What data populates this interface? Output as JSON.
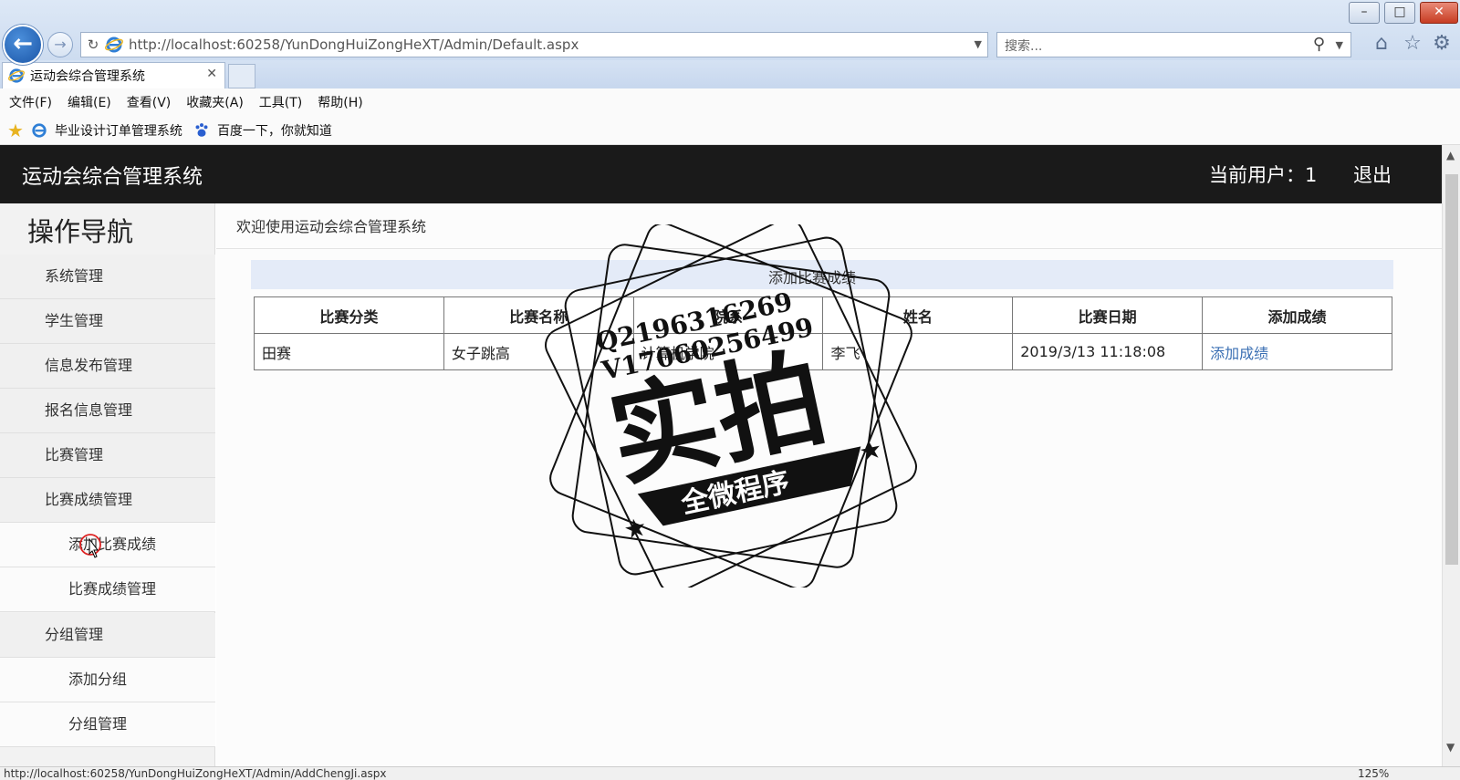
{
  "browser": {
    "window_controls": {
      "minimize": "–",
      "maximize": "□",
      "close": "✕"
    },
    "url": "http://localhost:60258/YunDongHuiZongHeXT/Admin/Default.aspx",
    "url_host": "localhost",
    "search_placeholder": "搜索...",
    "tab_title": "运动会综合管理系统",
    "menu": [
      "文件(F)",
      "编辑(E)",
      "查看(V)",
      "收藏夹(A)",
      "工具(T)",
      "帮助(H)"
    ],
    "favorites": [
      "毕业设计订单管理系统",
      "百度一下，你就知道"
    ],
    "status_url": "http://localhost:60258/YunDongHuiZongHeXT/Admin/AddChengJi.aspx",
    "zoom": "125%",
    "icons": [
      "back-icon",
      "forward-icon",
      "refresh-icon",
      "ie-icon",
      "search-icon",
      "home-icon",
      "favorites-star-icon",
      "gear-icon"
    ]
  },
  "header": {
    "title": "运动会综合管理系统",
    "current_user": "当前用户：1",
    "logout": "退出"
  },
  "sidebar": {
    "title": "操作导航",
    "items": [
      {
        "label": "系统管理",
        "level": "top"
      },
      {
        "label": "学生管理",
        "level": "top"
      },
      {
        "label": "信息发布管理",
        "level": "top"
      },
      {
        "label": "报名信息管理",
        "level": "top"
      },
      {
        "label": "比赛管理",
        "level": "top"
      },
      {
        "label": "比赛成绩管理",
        "level": "top"
      },
      {
        "label": "添加比赛成绩",
        "level": "sub"
      },
      {
        "label": "比赛成绩管理",
        "level": "sub"
      },
      {
        "label": "分组管理",
        "level": "top"
      },
      {
        "label": "添加分组",
        "level": "sub"
      },
      {
        "label": "分组管理",
        "level": "sub"
      }
    ]
  },
  "main": {
    "welcome": "欢迎使用运动会综合管理系统",
    "panel_title": "添加比赛成绩",
    "table": {
      "columns": [
        "比赛分类",
        "比赛名称",
        "院系",
        "姓名",
        "比赛日期",
        "添加成绩"
      ],
      "rows": [
        [
          "田赛",
          "女子跳高",
          "计算机学院",
          "李飞",
          "2019/3/13 11:18:08",
          "添加成绩"
        ]
      ]
    }
  },
  "watermark": {
    "line1": "Q2196316269",
    "line2": "V17060256499",
    "big": "实拍",
    "banner": "全微程序"
  },
  "colors": {
    "header_bg": "#1a1a1a",
    "link": "#3a6fb3",
    "panel_head": "#e4ebf8"
  }
}
